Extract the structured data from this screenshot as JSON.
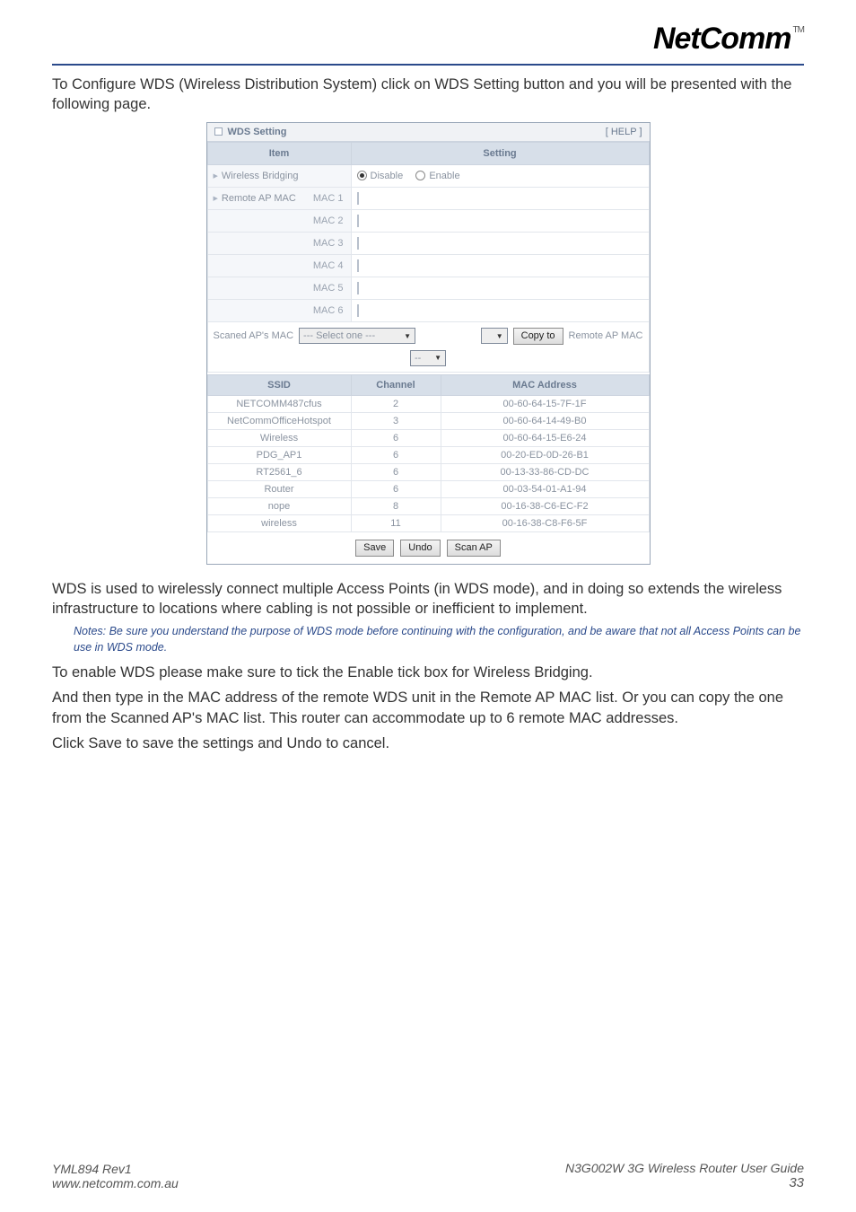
{
  "logo": {
    "text": "NetComm",
    "tm": "TM"
  },
  "intro": "To Configure WDS (Wireless Distribution System) click on WDS Setting button and you will be presented with the following page.",
  "panel": {
    "title": "WDS Setting",
    "help": "[ HELP ]",
    "col_item": "Item",
    "col_setting": "Setting",
    "wireless_bridging": "Wireless Bridging",
    "disable": "Disable",
    "enable": "Enable",
    "remote_ap_mac": "Remote AP MAC",
    "mac_labels": [
      "MAC 1",
      "MAC 2",
      "MAC 3",
      "MAC 4",
      "MAC 5",
      "MAC 6"
    ],
    "scanned_label": "Scaned AP's MAC",
    "select_one": "--- Select one ---",
    "copyto": "Copy to",
    "remote_ap_mac_btn": "Remote AP MAC",
    "small_select": "--",
    "ap_headers": {
      "ssid": "SSID",
      "channel": "Channel",
      "mac": "MAC Address"
    },
    "ap_rows": [
      {
        "ssid": "NETCOMM487cfus",
        "ch": "2",
        "mac": "00-60-64-15-7F-1F"
      },
      {
        "ssid": "NetCommOfficeHotspot",
        "ch": "3",
        "mac": "00-60-64-14-49-B0"
      },
      {
        "ssid": "Wireless",
        "ch": "6",
        "mac": "00-60-64-15-E6-24"
      },
      {
        "ssid": "PDG_AP1",
        "ch": "6",
        "mac": "00-20-ED-0D-26-B1"
      },
      {
        "ssid": "RT2561_6",
        "ch": "6",
        "mac": "00-13-33-86-CD-DC"
      },
      {
        "ssid": "Router",
        "ch": "6",
        "mac": "00-03-54-01-A1-94"
      },
      {
        "ssid": "nope",
        "ch": "8",
        "mac": "00-16-38-C6-EC-F2"
      },
      {
        "ssid": "wireless",
        "ch": "11",
        "mac": "00-16-38-C8-F6-5F"
      }
    ],
    "buttons": {
      "save": "Save",
      "undo": "Undo",
      "scan": "Scan AP"
    }
  },
  "para_wds_desc": "WDS is used to wirelessly connect multiple Access Points (in WDS mode), and in doing so extends the wireless infrastructure to locations where cabling is not possible or inefficient to implement.",
  "note": "Notes: Be sure you understand the purpose of WDS mode before continuing with the configuration, and be aware that not all Access Points can be use in WDS mode.",
  "para_enable": "To enable WDS please make sure to tick the Enable tick box for Wireless Bridging.",
  "para_mac": "And then type in the MAC address of the remote WDS unit in the Remote AP MAC list. Or you can copy the one from the Scanned AP's MAC list. This router can accommodate up to 6 remote MAC addresses.",
  "para_save": "Click Save to save the settings and Undo to cancel.",
  "footer": {
    "left1": "YML894 Rev1",
    "left2": "www.netcomm.com.au",
    "right1": "N3G002W 3G Wireless Router User Guide",
    "right2": "33"
  }
}
